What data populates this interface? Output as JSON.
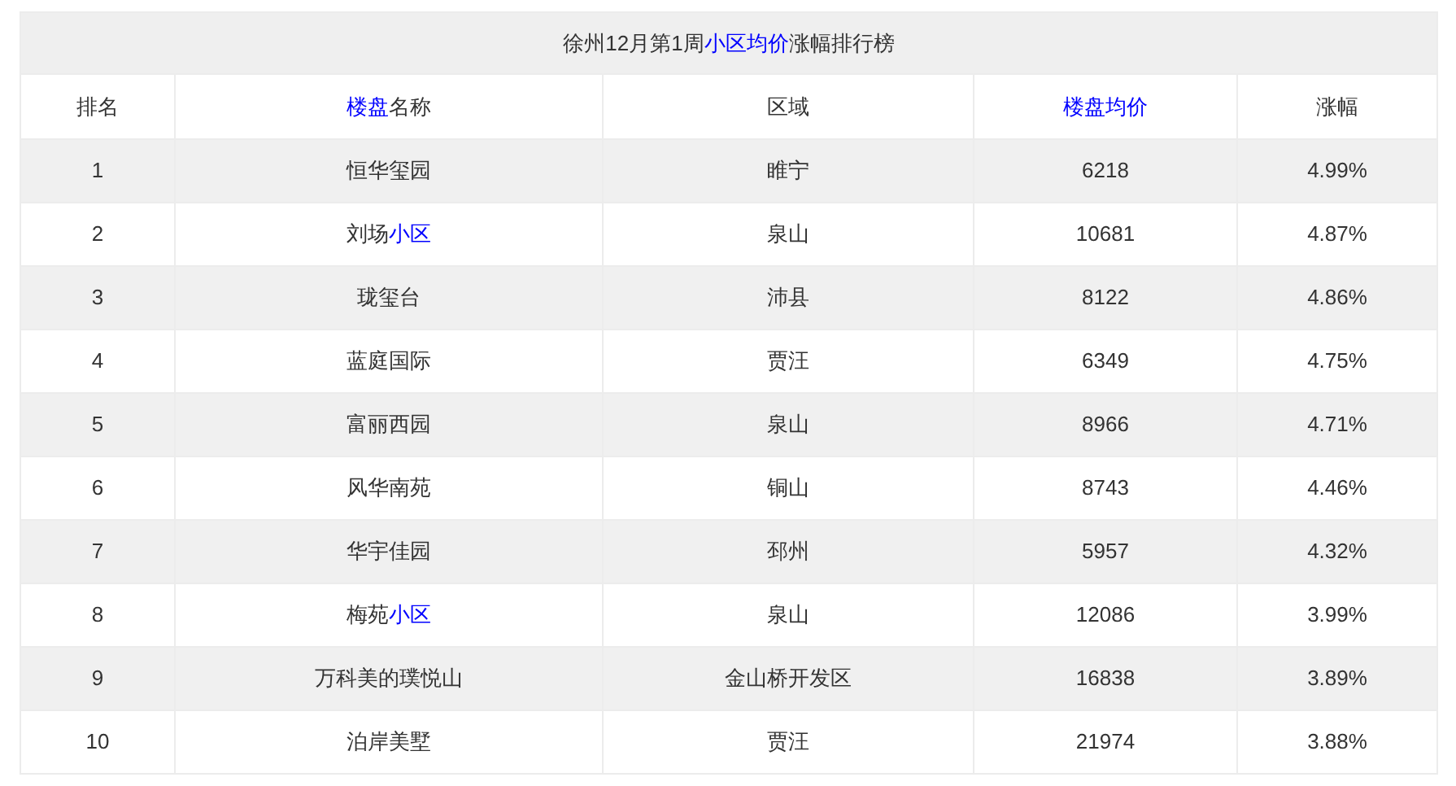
{
  "title": [
    {
      "text": "徐州12月第1周",
      "link": false
    },
    {
      "text": "小区均价",
      "link": true
    },
    {
      "text": "涨幅排行榜",
      "link": false
    }
  ],
  "columns": [
    [
      {
        "text": "排名",
        "link": false
      }
    ],
    [
      {
        "text": "楼盘",
        "link": true
      },
      {
        "text": "名称",
        "link": false
      }
    ],
    [
      {
        "text": "区域",
        "link": false
      }
    ],
    [
      {
        "text": "楼盘均价",
        "link": true
      }
    ],
    [
      {
        "text": "涨幅",
        "link": false
      }
    ]
  ],
  "rows": [
    [
      [
        {
          "text": "1",
          "link": false
        }
      ],
      [
        {
          "text": "恒华玺园",
          "link": false
        }
      ],
      [
        {
          "text": "睢宁",
          "link": false
        }
      ],
      [
        {
          "text": "6218",
          "link": false
        }
      ],
      [
        {
          "text": "4.99%",
          "link": false
        }
      ]
    ],
    [
      [
        {
          "text": "2",
          "link": false
        }
      ],
      [
        {
          "text": "刘场",
          "link": false
        },
        {
          "text": "小区",
          "link": true
        }
      ],
      [
        {
          "text": "泉山",
          "link": false
        }
      ],
      [
        {
          "text": "10681",
          "link": false
        }
      ],
      [
        {
          "text": "4.87%",
          "link": false
        }
      ]
    ],
    [
      [
        {
          "text": "3",
          "link": false
        }
      ],
      [
        {
          "text": "珑玺台",
          "link": false
        }
      ],
      [
        {
          "text": "沛县",
          "link": false
        }
      ],
      [
        {
          "text": "8122",
          "link": false
        }
      ],
      [
        {
          "text": "4.86%",
          "link": false
        }
      ]
    ],
    [
      [
        {
          "text": "4",
          "link": false
        }
      ],
      [
        {
          "text": "蓝庭国际",
          "link": false
        }
      ],
      [
        {
          "text": "贾汪",
          "link": false
        }
      ],
      [
        {
          "text": "6349",
          "link": false
        }
      ],
      [
        {
          "text": "4.75%",
          "link": false
        }
      ]
    ],
    [
      [
        {
          "text": "5",
          "link": false
        }
      ],
      [
        {
          "text": "富丽西园",
          "link": false
        }
      ],
      [
        {
          "text": "泉山",
          "link": false
        }
      ],
      [
        {
          "text": "8966",
          "link": false
        }
      ],
      [
        {
          "text": "4.71%",
          "link": false
        }
      ]
    ],
    [
      [
        {
          "text": "6",
          "link": false
        }
      ],
      [
        {
          "text": "风华南苑",
          "link": false
        }
      ],
      [
        {
          "text": "铜山",
          "link": false
        }
      ],
      [
        {
          "text": "8743",
          "link": false
        }
      ],
      [
        {
          "text": "4.46%",
          "link": false
        }
      ]
    ],
    [
      [
        {
          "text": "7",
          "link": false
        }
      ],
      [
        {
          "text": "华宇佳园",
          "link": false
        }
      ],
      [
        {
          "text": "邳州",
          "link": false
        }
      ],
      [
        {
          "text": "5957",
          "link": false
        }
      ],
      [
        {
          "text": "4.32%",
          "link": false
        }
      ]
    ],
    [
      [
        {
          "text": "8",
          "link": false
        }
      ],
      [
        {
          "text": "梅苑",
          "link": false
        },
        {
          "text": "小区",
          "link": true
        }
      ],
      [
        {
          "text": "泉山",
          "link": false
        }
      ],
      [
        {
          "text": "12086",
          "link": false
        }
      ],
      [
        {
          "text": "3.99%",
          "link": false
        }
      ]
    ],
    [
      [
        {
          "text": "9",
          "link": false
        }
      ],
      [
        {
          "text": "万科美的璞悦山",
          "link": false
        }
      ],
      [
        {
          "text": "金山桥开发区",
          "link": false
        }
      ],
      [
        {
          "text": "16838",
          "link": false
        }
      ],
      [
        {
          "text": "3.89%",
          "link": false
        }
      ]
    ],
    [
      [
        {
          "text": "10",
          "link": false
        }
      ],
      [
        {
          "text": "泊岸美墅",
          "link": false
        }
      ],
      [
        {
          "text": "贾汪",
          "link": false
        }
      ],
      [
        {
          "text": "21974",
          "link": false
        }
      ],
      [
        {
          "text": "3.88%",
          "link": false
        }
      ]
    ]
  ]
}
